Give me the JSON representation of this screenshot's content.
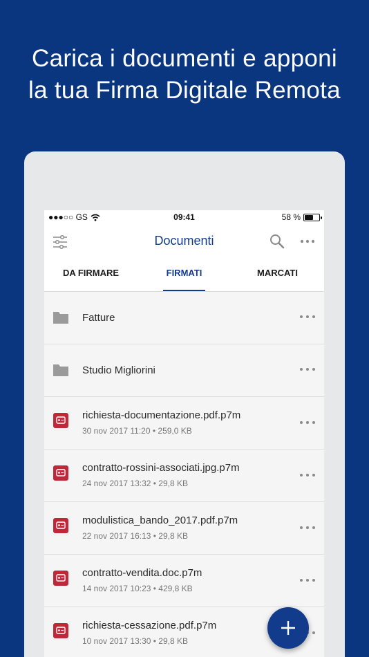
{
  "headline": {
    "line1": "Carica i documenti e apponi",
    "line2": "la tua Firma Digitale Remota"
  },
  "statusbar": {
    "carrier": "●●●○○ GS",
    "time": "09:41",
    "battery_text": "58 %",
    "battery_level": 0.58
  },
  "appbar": {
    "title": "Documenti",
    "icons": [
      "filter-icon",
      "search-icon",
      "more-icon"
    ]
  },
  "tabs": [
    {
      "label": "DA FIRMARE",
      "active": false
    },
    {
      "label": "FIRMATI",
      "active": true
    },
    {
      "label": "MARCATI",
      "active": false
    }
  ],
  "items": [
    {
      "type": "folder",
      "name": "Fatture",
      "meta": ""
    },
    {
      "type": "folder",
      "name": "Studio Migliorini",
      "meta": ""
    },
    {
      "type": "file",
      "name": "richiesta-documentazione.pdf.p7m",
      "meta": "30 nov 2017 11:20 • 259,0 KB"
    },
    {
      "type": "file",
      "name": "contratto-rossini-associati.jpg.p7m",
      "meta": "24 nov 2017 13:32 • 29,8 KB"
    },
    {
      "type": "file",
      "name": "modulistica_bando_2017.pdf.p7m",
      "meta": "22 nov 2017 16:13 • 29,8 KB"
    },
    {
      "type": "file",
      "name": "contratto-vendita.doc.p7m",
      "meta": "14 nov 2017 10:23 • 429,8 KB"
    },
    {
      "type": "file",
      "name": "richiesta-cessazione.pdf.p7m",
      "meta": "10 nov 2017 13:30 • 29,8 KB"
    }
  ],
  "colors": {
    "background": "#0a3680",
    "accent": "#133b8c",
    "file_icon": "#c0283a",
    "folder_icon": "#9a9a9a"
  },
  "fab": {
    "icon": "plus-icon"
  }
}
